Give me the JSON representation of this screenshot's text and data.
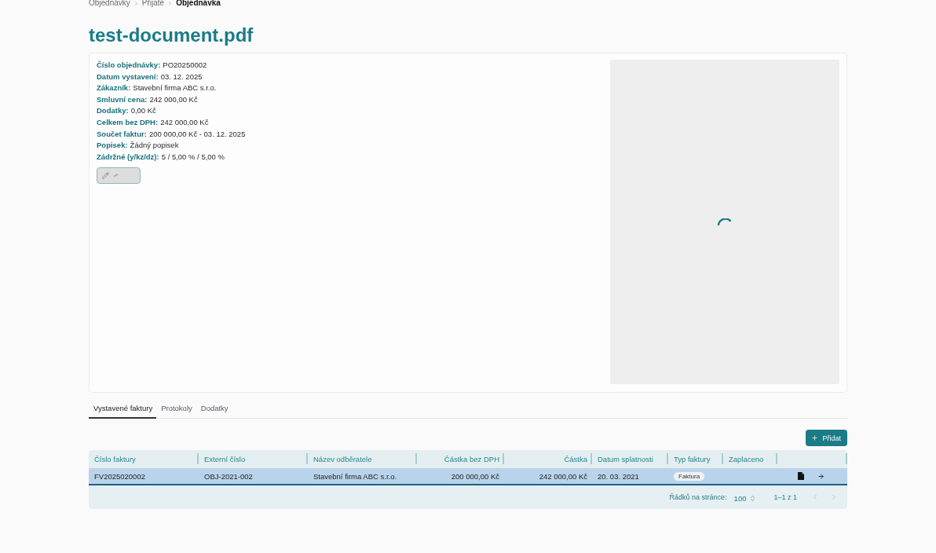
{
  "breadcrumb": [
    {
      "label": "Objednávky",
      "current": false
    },
    {
      "label": "Přijaté",
      "current": false
    },
    {
      "label": "Objednávka",
      "current": true
    }
  ],
  "title": "test-document.pdf",
  "details": [
    {
      "label": "Číslo objednávky:",
      "value": "PO20250002"
    },
    {
      "label": "Datum vystavení:",
      "value": "03. 12. 2025"
    },
    {
      "label": "Zákazník:",
      "value": "Stavební firma ABC s.r.o."
    },
    {
      "label": "Smluvní cena:",
      "value": "242 000,00 Kč"
    },
    {
      "label": "Dodatky:",
      "value": "0,00 Kč"
    },
    {
      "label": "Celkem bez DPH:",
      "value": "242 000,00 Kč"
    },
    {
      "label": "Součet faktur:",
      "value": "200 000,00 Kč - 03. 12. 2025"
    },
    {
      "label": "Popisek:",
      "value": "Žádný popisek"
    },
    {
      "label": "Zádržné (y/kz/dz):",
      "value": "5 / 5,00 % / 5,00 %"
    }
  ],
  "edit_button": {
    "disabled": true,
    "loading": true
  },
  "preview": {
    "loading": true
  },
  "tabs": [
    {
      "label": "Vystavené faktury",
      "selected": true
    },
    {
      "label": "Protokoly",
      "selected": false
    },
    {
      "label": "Dodatky",
      "selected": false
    }
  ],
  "add_button": {
    "label": "Přidat"
  },
  "table": {
    "columns": [
      {
        "label": "Číslo faktury",
        "kind": "text"
      },
      {
        "label": "Externí číslo",
        "kind": "text"
      },
      {
        "label": "Název odběratele",
        "kind": "text"
      },
      {
        "label": "Částka bez DPH",
        "kind": "amount"
      },
      {
        "label": "Částka",
        "kind": "amount"
      },
      {
        "label": "Datum splatnosti",
        "kind": "text"
      },
      {
        "label": "Typ faktury",
        "kind": "tag"
      },
      {
        "label": "Zaplaceno",
        "kind": "text"
      }
    ],
    "rows": [
      {
        "selected": true,
        "invoice_number": "FV2025020002",
        "external_number": "OBJ-2021-002",
        "customer": "Stavební firma ABC s.r.o.",
        "amount_without_vat": "200 000,00 Kč",
        "amount": "242 000,00 Kč",
        "due_date": "20. 03. 2021",
        "invoice_type": "Faktura"
      }
    ]
  },
  "pagination": {
    "rows_per_page_label": "Řádků na stránce:",
    "rows_per_page": "100",
    "range": "1–1 z 1",
    "previous": {
      "disabled": true
    },
    "next": {
      "disabled": true
    }
  }
}
